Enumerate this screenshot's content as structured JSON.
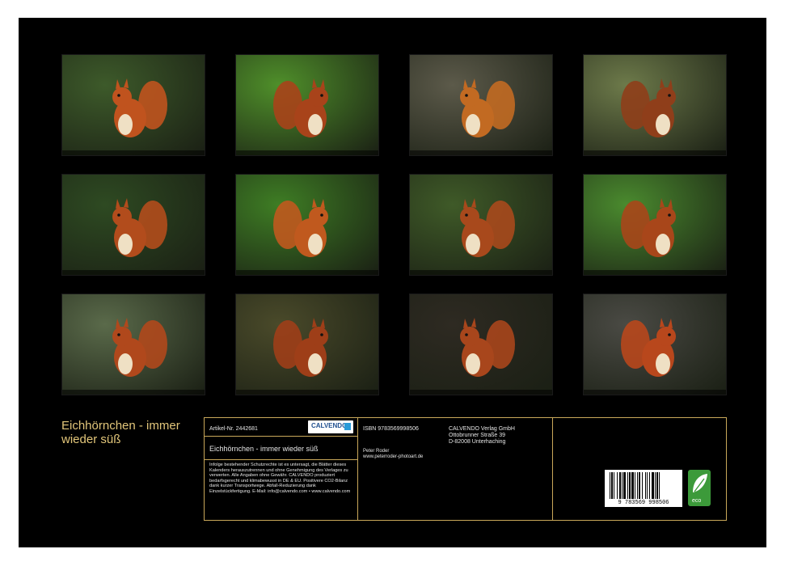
{
  "calendar": {
    "title": "Eichhörnchen - immer wieder süß",
    "photos": [
      {
        "name": "photo-january",
        "bg": "#3d5a2a",
        "fur": "#c0531e"
      },
      {
        "name": "photo-february",
        "bg": "#4f8f2a",
        "fur": "#a8431a"
      },
      {
        "name": "photo-march",
        "bg": "#5c5a4a",
        "fur": "#c26a22"
      },
      {
        "name": "photo-april",
        "bg": "#6d7a4a",
        "fur": "#8f3e1a"
      },
      {
        "name": "photo-may",
        "bg": "#2e4a22",
        "fur": "#b24c1c"
      },
      {
        "name": "photo-june",
        "bg": "#3e7d24",
        "fur": "#c0591e"
      },
      {
        "name": "photo-july",
        "bg": "#3f5a28",
        "fur": "#a8491c"
      },
      {
        "name": "photo-august",
        "bg": "#4a8a2e",
        "fur": "#a8461a"
      },
      {
        "name": "photo-september",
        "bg": "#5a6a4a",
        "fur": "#b0481c"
      },
      {
        "name": "photo-october",
        "bg": "#4a4a2a",
        "fur": "#9e3e18"
      },
      {
        "name": "photo-november",
        "bg": "#2e2a22",
        "fur": "#a8461c"
      },
      {
        "name": "photo-december",
        "bg": "#4a4a44",
        "fur": "#b8471c"
      }
    ]
  },
  "info": {
    "article_label": "Artikel-Nr. 2442681",
    "brand": "CALVENDO",
    "product_title": "Eichhörnchen - immer wieder süß",
    "legal_text": "Infolge bestehender Schutzrechte ist es untersagt, die Blätter dieses Kalenders herauszutrennen und ohne Genehmigung des Verlages zu verwerten. Alle Angaben ohne Gewähr. CALVENDO produziert bedarfsgerecht und klimabewusst in DE & EU. Positivere CO2-Bilanz dank kurzer Transportwege. Abfall-Reduzierung dank Einzelstückfertigung. E-Mail: info@calvendo.com • www.calvendo.com",
    "isbn": "ISBN 9783569998506",
    "author": "Peter Roder",
    "author_url": "www.peterroder-photoart.de",
    "publisher_name": "CALVENDO Verlag GmbH",
    "publisher_street": "Ottobrunner Straße 39",
    "publisher_city": "D-82008 Unterhaching",
    "barcode_number": "9 783569 998506",
    "eco_label": "eco"
  },
  "colors": {
    "page_background": "#000000",
    "accent_gold": "#c9a85a"
  }
}
